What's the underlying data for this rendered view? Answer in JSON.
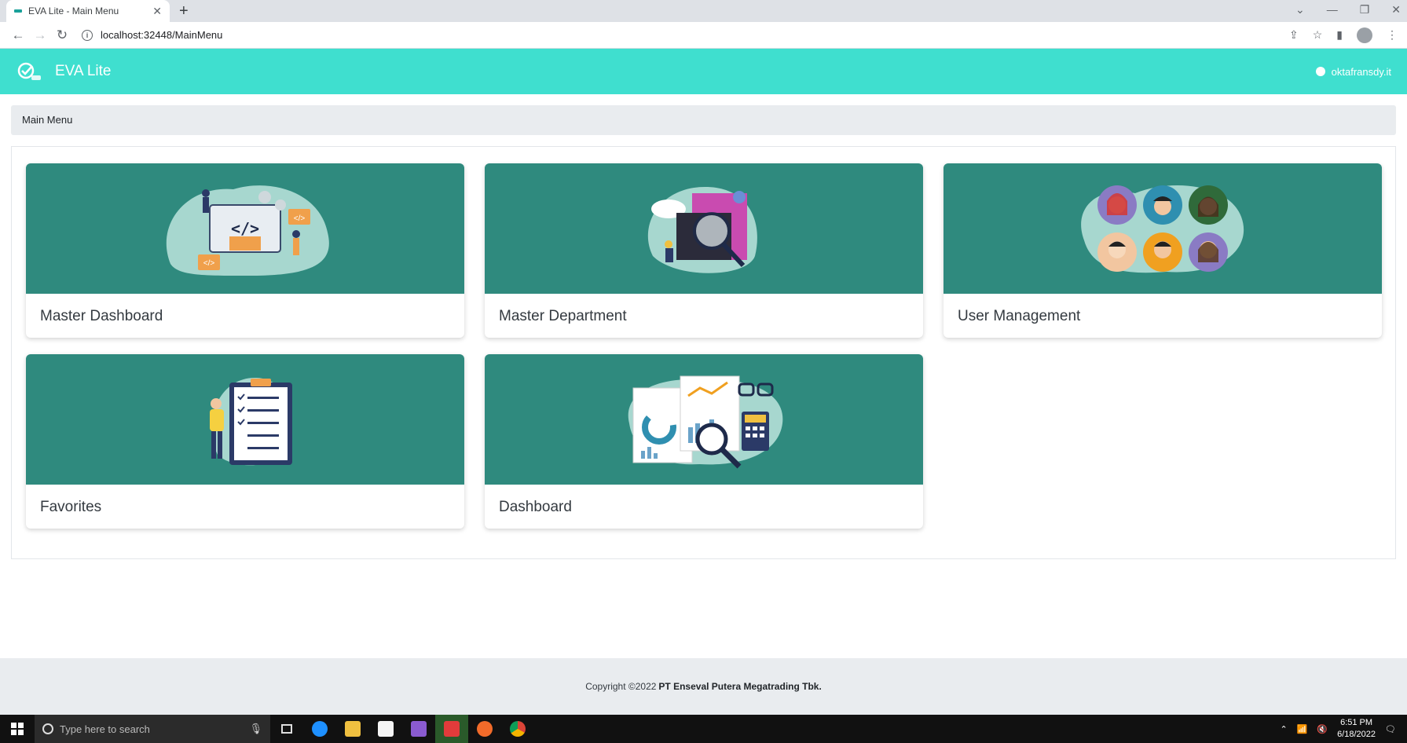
{
  "browser": {
    "tab_title": "EVA Lite - Main Menu",
    "url": "localhost:32448/MainMenu"
  },
  "app": {
    "brand": "EVA Lite",
    "username": "oktafransdy.it"
  },
  "breadcrumb": "Main Menu",
  "cards": [
    {
      "title": "Master Dashboard",
      "icon": "code-devs-illustration"
    },
    {
      "title": "Master Department",
      "icon": "magnifier-servers-illustration"
    },
    {
      "title": "User Management",
      "icon": "user-avatars-illustration"
    },
    {
      "title": "Favorites",
      "icon": "checklist-illustration"
    },
    {
      "title": "Dashboard",
      "icon": "charts-report-illustration"
    }
  ],
  "footer": {
    "copyright": "Copyright ©2022",
    "company": "PT Enseval Putera Megatrading Tbk."
  },
  "taskbar": {
    "search_placeholder": "Type here to search",
    "time": "6:51 PM",
    "date": "6/18/2022"
  },
  "colors": {
    "header": "#3fdfcf",
    "card_image_bg": "#2f8a7e"
  }
}
